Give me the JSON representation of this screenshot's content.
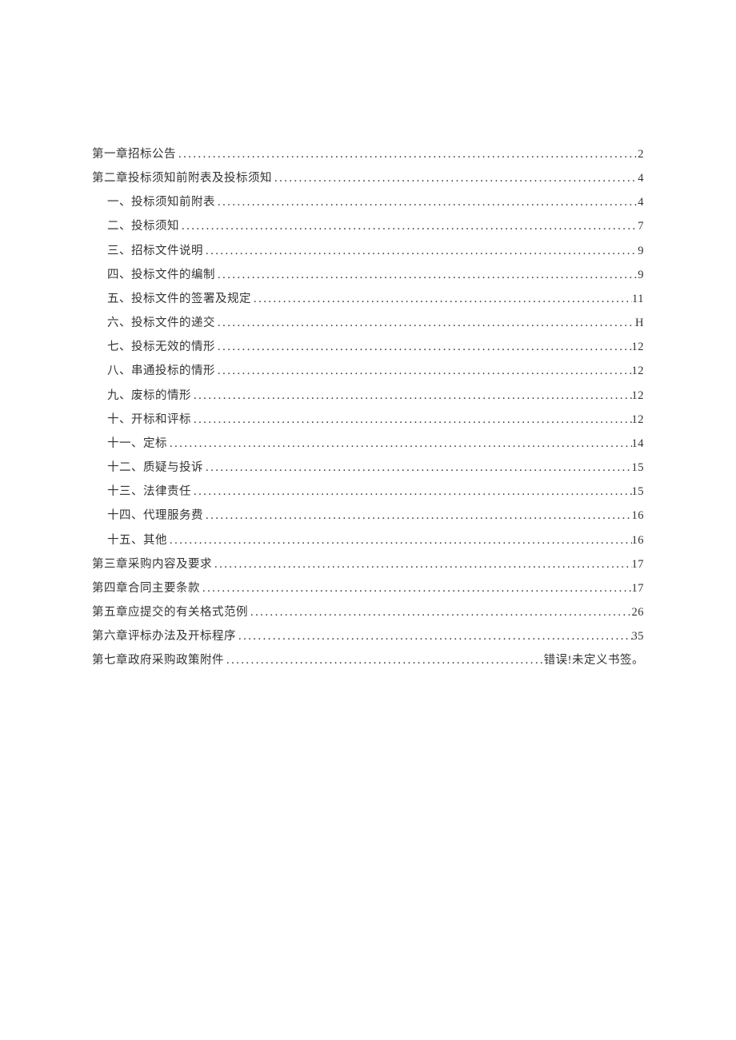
{
  "toc": [
    {
      "level": 0,
      "title": "第一章招标公告",
      "page": "2"
    },
    {
      "level": 0,
      "title": "第二章投标须知前附表及投标须知",
      "page": "4"
    },
    {
      "level": 1,
      "title": "一、投标须知前附表",
      "page": "4"
    },
    {
      "level": 1,
      "title": "二、投标须知",
      "page": "7"
    },
    {
      "level": 1,
      "title": "三、招标文件说明",
      "page": "9"
    },
    {
      "level": 1,
      "title": "四、投标文件的编制",
      "page": "9"
    },
    {
      "level": 1,
      "title": "五、投标文件的签署及规定",
      "page": "11"
    },
    {
      "level": 1,
      "title": "六、投标文件的递交",
      "page": "H"
    },
    {
      "level": 1,
      "title": "七、投标无效的情形",
      "page": "12"
    },
    {
      "level": 1,
      "title": "八、串通投标的情形",
      "page": "12"
    },
    {
      "level": 1,
      "title": "九、废标的情形",
      "page": "12"
    },
    {
      "level": 1,
      "title": "十、开标和评标",
      "page": "12"
    },
    {
      "level": 1,
      "title": "十一、定标",
      "page": "14"
    },
    {
      "level": 1,
      "title": "十二、质疑与投诉",
      "page": "15"
    },
    {
      "level": 1,
      "title": "十三、法律责任",
      "page": "15"
    },
    {
      "level": 1,
      "title": "十四、代理服务费",
      "page": "16"
    },
    {
      "level": 1,
      "title": "十五、其他",
      "page": "16"
    },
    {
      "level": 0,
      "title": "第三章采购内容及要求",
      "page": "17"
    },
    {
      "level": 0,
      "title": "第四章合同主要条款",
      "page": "17"
    },
    {
      "level": 0,
      "title": "第五章应提交的有关格式范例",
      "page": "26"
    },
    {
      "level": 0,
      "title": "第六章评标办法及开标程序",
      "page": "35"
    },
    {
      "level": 0,
      "title": "第七章政府采购政策附件",
      "page": "错误!未定义书签。"
    }
  ]
}
